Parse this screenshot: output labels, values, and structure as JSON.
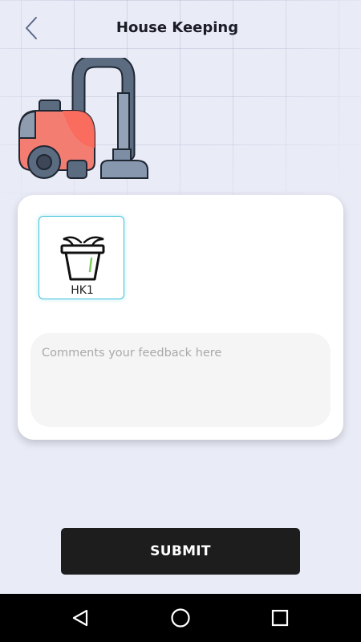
{
  "header": {
    "title": "House Keeping",
    "back_icon": "chevron-left-icon"
  },
  "hero": {
    "icon": "vacuum-cleaner-illustration"
  },
  "service_card": {
    "items": [
      {
        "label": "HK1",
        "icon": "trash-bin-icon",
        "selected": true
      }
    ],
    "comment": {
      "value": "",
      "placeholder": "Comments your feedback here"
    }
  },
  "submit_label": "SUBMIT",
  "system_nav": {
    "back_icon": "nav-back-icon",
    "home_icon": "nav-home-icon",
    "recents_icon": "nav-recents-icon"
  },
  "colors": {
    "background": "#e9ebf7",
    "card": "#ffffff",
    "accent_border": "#3fc2dc",
    "button": "#1d1d1d",
    "vacuum_body": "#f47d72",
    "vacuum_dark": "#5b6b80"
  }
}
